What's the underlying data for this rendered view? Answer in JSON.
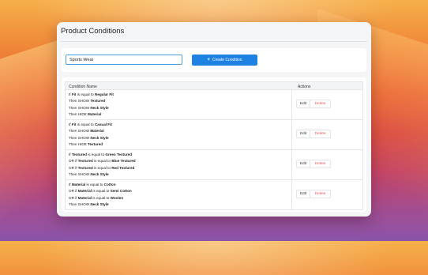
{
  "page": {
    "title": "Product Conditions"
  },
  "form": {
    "search_value": "Sports Wear",
    "create_label": "Create Condition"
  },
  "table": {
    "headers": {
      "name": "Condition Name",
      "actions": "Actions"
    },
    "edit_label": "Edit",
    "delete_label": "Delete",
    "rows": [
      {
        "lines": [
          {
            "pre": "If ",
            "field": "Fit",
            "mid": " is equal to ",
            "value": "Regular Fit"
          },
          {
            "pre": "Then SHOW ",
            "field": "Textured"
          },
          {
            "pre": "Then SHOW ",
            "field": "Neck Style"
          },
          {
            "pre": "Then HIDE ",
            "field": "Material"
          }
        ]
      },
      {
        "lines": [
          {
            "pre": "If ",
            "field": "Fit",
            "mid": " is equal to ",
            "value": "Casual Fit"
          },
          {
            "pre": "Then SHOW ",
            "field": "Material"
          },
          {
            "pre": "Then SHOW ",
            "field": "Neck Style"
          },
          {
            "pre": "Then HIDE ",
            "field": "Textured"
          }
        ]
      },
      {
        "lines": [
          {
            "pre": "If ",
            "field": "Textured",
            "mid": " is equal to ",
            "value": "Green Textured"
          },
          {
            "pre": "OR if ",
            "field": "Textured",
            "mid": " is equal to ",
            "value": "Blue Textured"
          },
          {
            "pre": "OR if ",
            "field": "Textured",
            "mid": " is equal to ",
            "value": "Red Textured"
          },
          {
            "pre": "Then SHOW ",
            "field": "Neck Style"
          }
        ]
      },
      {
        "lines": [
          {
            "pre": "If ",
            "field": "Material",
            "mid": " is equal to ",
            "value": "Cotton"
          },
          {
            "pre": "OR if ",
            "field": "Material",
            "mid": " is equal to ",
            "value": "Semi Cotton"
          },
          {
            "pre": "OR if ",
            "field": "Material",
            "mid": " is equal to ",
            "value": "Woolen"
          },
          {
            "pre": "Then SHOW ",
            "field": "Neck Style"
          }
        ]
      }
    ]
  },
  "colors": {
    "accent": "#1d82e1",
    "delete": "#e05a5a",
    "input_border": "#4a9fe0"
  },
  "icons": {
    "create": "plus-icon"
  }
}
